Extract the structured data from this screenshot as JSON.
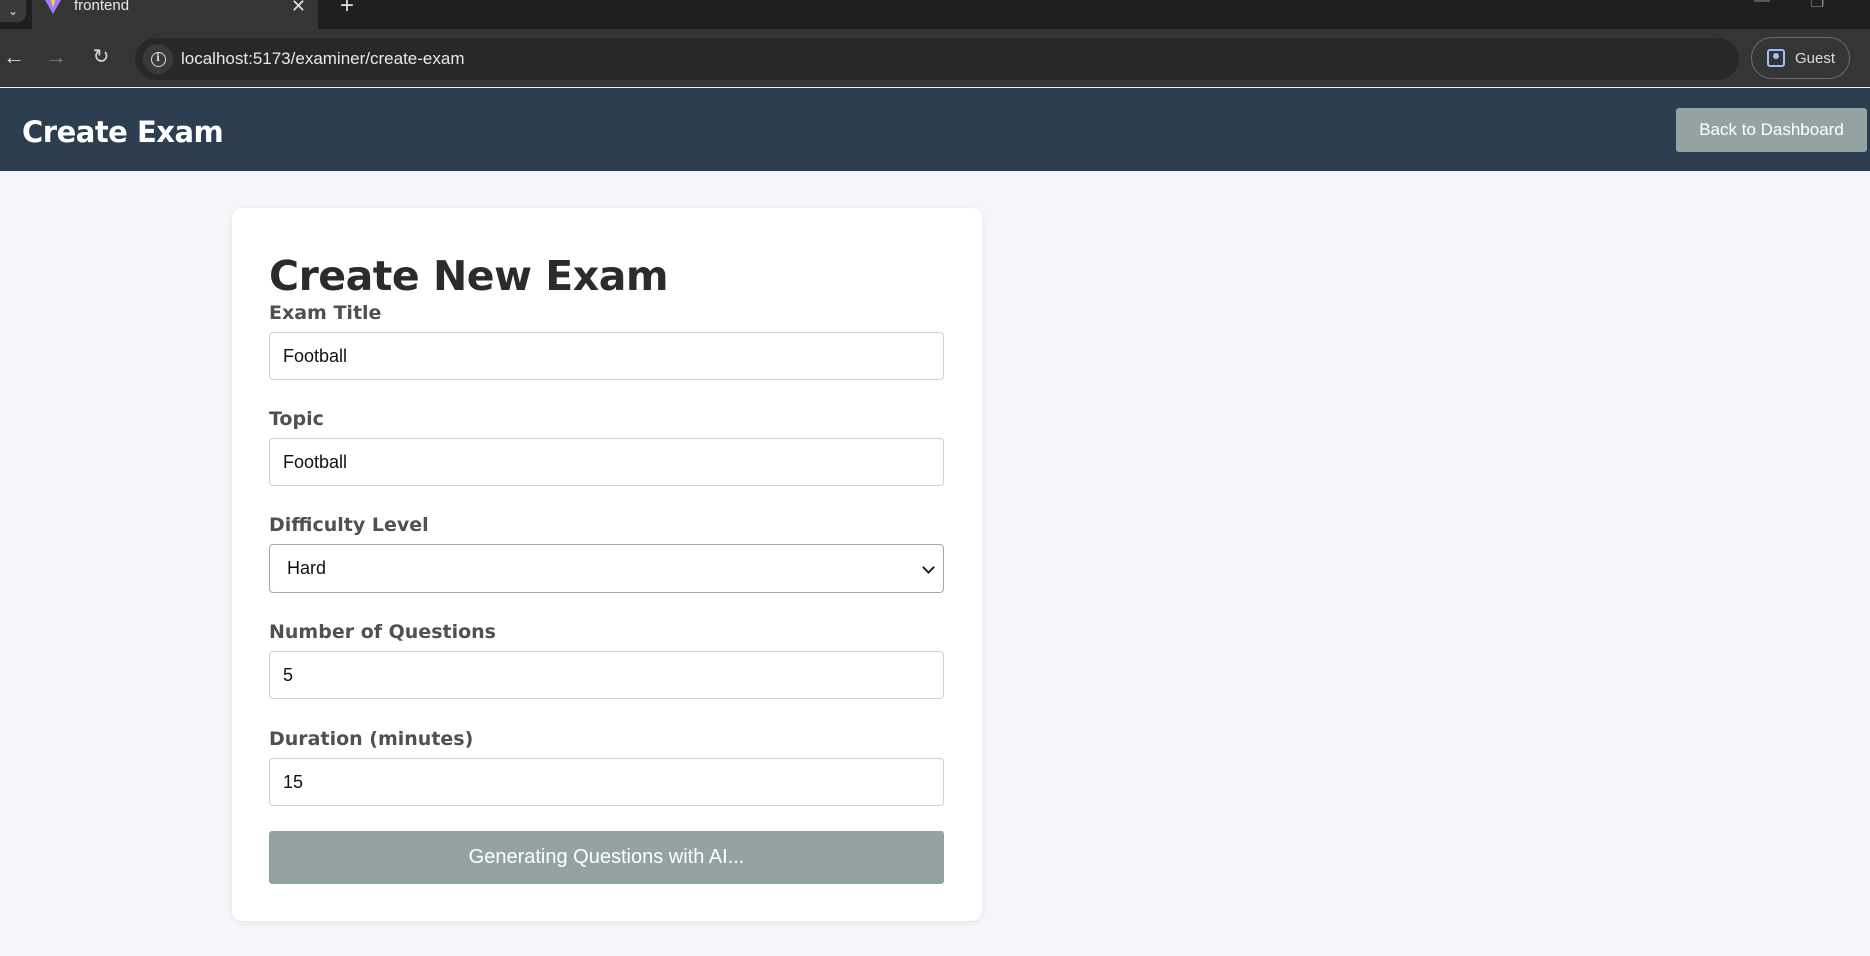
{
  "browser": {
    "tab_title": "frontend",
    "tab_close": "✕",
    "new_tab": "+",
    "url": "localhost:5173/examiner/create-exam",
    "profile_label": "Guest"
  },
  "header": {
    "title": "Create Exam",
    "back_button": "Back to Dashboard"
  },
  "form": {
    "title": "Create New Exam",
    "exam_title": {
      "label": "Exam Title",
      "value": "Football"
    },
    "topic": {
      "label": "Topic",
      "value": "Football"
    },
    "difficulty": {
      "label": "Difficulty Level",
      "value": "Hard"
    },
    "num_questions": {
      "label": "Number of Questions",
      "value": "5"
    },
    "duration": {
      "label": "Duration (minutes)",
      "value": "15"
    },
    "submit_label": "Generating Questions with AI..."
  },
  "colors": {
    "header_bg": "#2d3e50",
    "disabled_button": "#93a3a3",
    "page_bg": "#f5f6fa"
  }
}
